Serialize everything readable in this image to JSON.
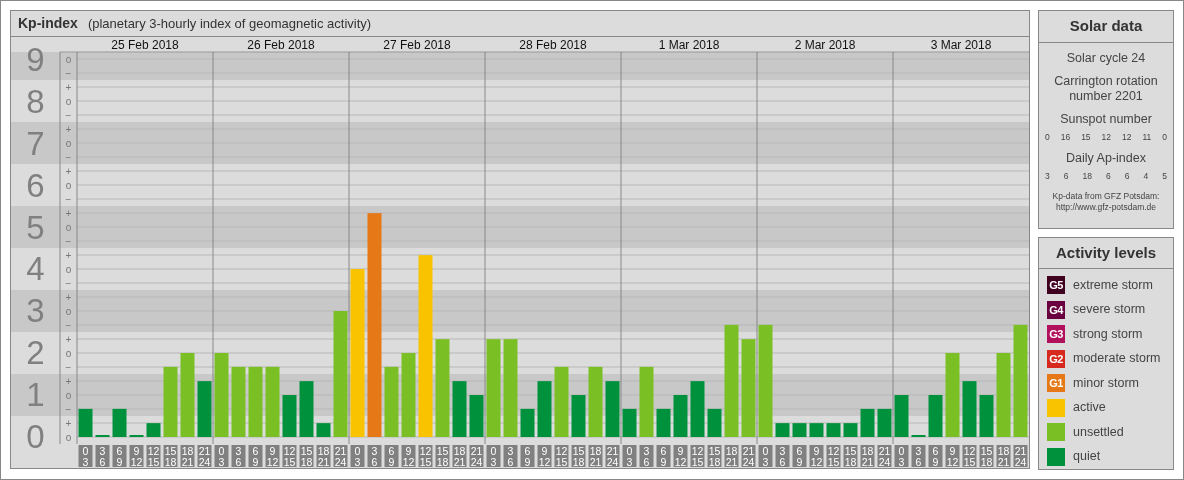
{
  "panel": {
    "title": "Kp-index",
    "subtitle": "(planetary 3-hourly index of geomagnetic activity)"
  },
  "chart": {
    "days": [
      "25 Feb 2018",
      "26 Feb 2018",
      "27 Feb 2018",
      "28 Feb 2018",
      "1 Mar 2018",
      "2 Mar 2018",
      "3 Mar 2018"
    ],
    "minor_ticks": [
      "o",
      "−",
      "+",
      "o",
      "−",
      "+",
      "o",
      "−",
      "+",
      "o",
      "−",
      "+",
      "o",
      "−",
      "+",
      "o",
      "−",
      "+",
      "o",
      "−",
      "+",
      "o",
      "−",
      "+",
      "o",
      "−",
      "+",
      "o"
    ],
    "chart_data": {
      "type": "bar",
      "grid": true,
      "ylim": [
        -0.1667,
        9.1667
      ],
      "yticks": [
        0,
        1,
        2,
        3,
        4,
        5,
        6,
        7,
        8,
        9
      ],
      "categories": [
        "0 3",
        "3 6",
        "6 9",
        "9 12",
        "12 15",
        "15 18",
        "18 21",
        "21 24",
        "0 3",
        "3 6",
        "6 9",
        "9 12",
        "12 15",
        "15 18",
        "18 21",
        "21 24",
        "0 3",
        "3 6",
        "6 9",
        "9 12",
        "12 15",
        "15 18",
        "18 21",
        "21 24",
        "0 3",
        "3 6",
        "6 9",
        "9 12",
        "12 15",
        "15 18",
        "18 21",
        "21 24",
        "0 3",
        "3 6",
        "6 9",
        "9 12",
        "12 15",
        "15 18",
        "18 21",
        "21 24",
        "0 3",
        "3 6",
        "6 9",
        "9 12",
        "12 15",
        "15 18",
        "18 21",
        "21 24",
        "0 3",
        "3 6",
        "6 9",
        "9 12",
        "12 15",
        "15 18",
        "18 21",
        "21 24"
      ],
      "series": [
        {
          "color": "#e67817",
          "values": [
            null,
            null,
            null,
            null,
            null,
            null,
            null,
            null,
            null,
            null,
            null,
            null,
            null,
            null,
            null,
            null,
            null,
            5.33,
            null,
            null,
            null,
            null,
            null,
            null,
            null,
            null,
            null,
            null,
            null,
            null,
            null,
            null,
            null,
            null,
            null,
            null,
            null,
            null,
            null,
            null,
            null,
            null,
            null,
            null,
            null,
            null,
            null,
            null,
            null,
            null,
            null,
            null,
            null,
            null,
            null,
            null
          ]
        },
        {
          "color": "#f9c300",
          "values": [
            null,
            null,
            null,
            null,
            null,
            null,
            null,
            null,
            null,
            null,
            null,
            null,
            null,
            null,
            null,
            null,
            4,
            null,
            null,
            null,
            4.33,
            null,
            null,
            null,
            null,
            null,
            null,
            null,
            null,
            null,
            null,
            null,
            null,
            null,
            null,
            null,
            null,
            null,
            null,
            null,
            null,
            null,
            null,
            null,
            null,
            null,
            null,
            null,
            null,
            null,
            null,
            null,
            null,
            null,
            null,
            null
          ]
        },
        {
          "color": "#7ac024",
          "values": [
            null,
            null,
            null,
            null,
            null,
            1.67,
            2,
            null,
            2,
            1.67,
            1.67,
            1.67,
            null,
            null,
            null,
            3,
            null,
            null,
            1.67,
            2,
            null,
            2.33,
            null,
            null,
            2.33,
            2.33,
            null,
            null,
            1.67,
            null,
            1.67,
            null,
            null,
            1.67,
            null,
            null,
            null,
            null,
            2.67,
            2.33,
            2.67,
            null,
            null,
            null,
            null,
            null,
            null,
            null,
            null,
            null,
            null,
            2,
            null,
            null,
            2,
            2.67
          ]
        },
        {
          "color": "#00913c",
          "values": [
            0.67,
            0,
            0.67,
            0,
            0.33,
            null,
            null,
            1.33,
            null,
            null,
            null,
            null,
            1,
            1.33,
            0.33,
            null,
            null,
            null,
            null,
            null,
            null,
            null,
            1.33,
            1,
            null,
            null,
            0.67,
            1.33,
            null,
            1,
            null,
            1.33,
            0.67,
            null,
            0.67,
            1,
            1.33,
            0.67,
            null,
            null,
            null,
            0.33,
            0.33,
            0.33,
            0.33,
            0.33,
            0.67,
            0.67,
            1,
            0,
            1,
            null,
            1.33,
            1,
            null,
            null
          ]
        }
      ]
    }
  },
  "solar_data": {
    "title": "Solar data",
    "cycle": "Solar cycle 24",
    "rotation": "Carrington rotation number 2201",
    "sunspot": {
      "label": "Sunspot number",
      "values": [
        "0",
        "16",
        "15",
        "12",
        "12",
        "11",
        "0"
      ]
    },
    "ap_index": {
      "label": "Daily Ap-index",
      "values": [
        "3",
        "6",
        "18",
        "6",
        "6",
        "4",
        "5"
      ]
    },
    "source": [
      "Kp-data from GFZ Potsdam:",
      "http://www.gfz-potsdam.de"
    ]
  },
  "legend": {
    "title": "Activity levels",
    "items": [
      {
        "kind": "badge",
        "code": "G5",
        "label": "extreme storm",
        "color": "#3f0020"
      },
      {
        "kind": "badge",
        "code": "G4",
        "label": "severe storm",
        "color": "#6a0040"
      },
      {
        "kind": "badge",
        "code": "G3",
        "label": "strong storm",
        "color": "#b20f5c"
      },
      {
        "kind": "badge",
        "code": "G2",
        "label": "moderate storm",
        "color": "#d62a1e"
      },
      {
        "kind": "badge",
        "code": "G1",
        "label": "minor storm",
        "color": "#e67817"
      },
      {
        "kind": "swatch",
        "label": "active",
        "color": "#f9c300"
      },
      {
        "kind": "swatch",
        "label": "unsettled",
        "color": "#7ac024"
      },
      {
        "kind": "swatch",
        "label": "quiet",
        "color": "#00913c"
      }
    ]
  }
}
